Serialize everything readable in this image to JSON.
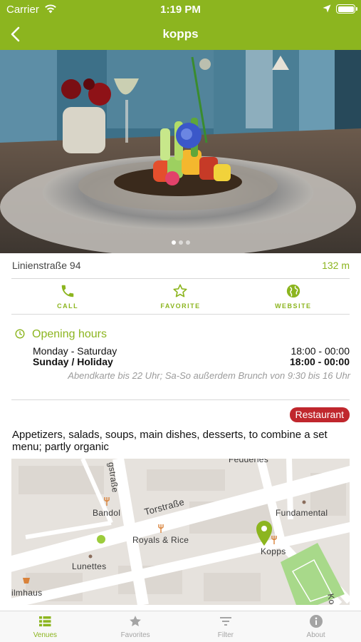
{
  "status_bar": {
    "carrier": "Carrier",
    "time": "1:19 PM"
  },
  "nav": {
    "title": "kopps",
    "back_icon": "chevron-left-icon"
  },
  "gallery": {
    "page_count": 3,
    "current_page": 1
  },
  "venue": {
    "address": "Linienstraße 94",
    "distance": "132 m"
  },
  "actions": [
    {
      "label": "CALL",
      "icon": "phone-icon"
    },
    {
      "label": "FAVORITE",
      "icon": "star-outline-icon"
    },
    {
      "label": "WEBSITE",
      "icon": "globe-icon"
    }
  ],
  "opening_hours": {
    "title": "Opening hours",
    "rows": [
      {
        "days": "Monday - Saturday",
        "hours": "18:00 - 00:00"
      },
      {
        "days": "Sunday / Holiday",
        "hours": "18:00 - 00:00"
      }
    ],
    "note": "Abendkarte bis 22 Uhr; Sa-So außerdem Brunch von 9:30 bis 16 Uhr"
  },
  "category_badge": "Restaurant",
  "description": "Appetizers, salads, soups, main dishes, desserts, to combine a set menu; partly organic",
  "map": {
    "labels": {
      "street_vertical": "gstraße",
      "torstrasse": "Torstraße",
      "bandol": "Bandol",
      "royals": "Royals & Rice",
      "fundamental": "Fundamental",
      "kopps": "Kopps",
      "lunettes": "Lunettes",
      "ilmhaus": "ilmhaus",
      "top_street": "Fedderles",
      "right_street": "Ko"
    }
  },
  "tabs": [
    {
      "label": "Venues",
      "icon": "list-icon",
      "active": true
    },
    {
      "label": "Favorites",
      "icon": "star-icon",
      "active": false
    },
    {
      "label": "Filter",
      "icon": "filter-icon",
      "active": false
    },
    {
      "label": "About",
      "icon": "info-icon",
      "active": false
    }
  ],
  "colors": {
    "brand": "#8cb51f",
    "badge": "#c0272d",
    "map_park": "#a8d98a"
  }
}
